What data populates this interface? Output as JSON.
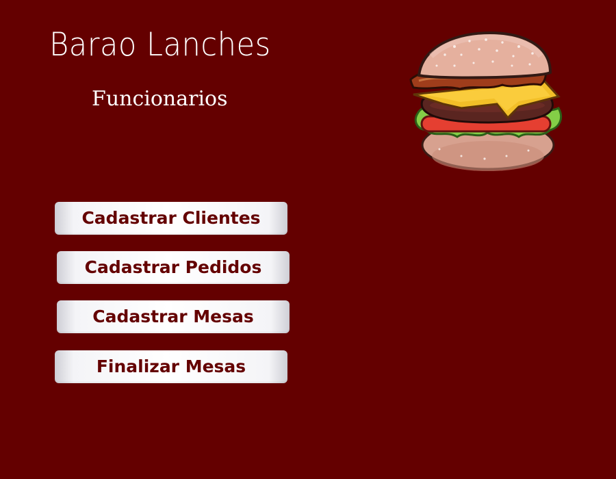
{
  "header": {
    "title": "Barao Lanches",
    "subtitle": "Funcionarios"
  },
  "illustration": {
    "icon": "burger-illustration"
  },
  "menu": {
    "items": [
      {
        "label": "Cadastrar Clientes"
      },
      {
        "label": "Cadastrar Pedidos"
      },
      {
        "label": "Cadastrar Mesas"
      },
      {
        "label": "Finalizar Mesas"
      }
    ]
  },
  "colors": {
    "background": "#640000",
    "button_text": "#640000",
    "title_text": "#ffffff"
  }
}
